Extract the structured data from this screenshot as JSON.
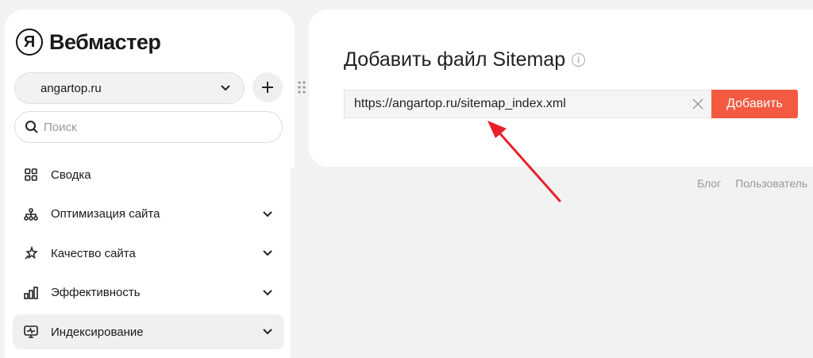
{
  "brand": {
    "logo_letter": "Я",
    "name": "Вебмастер"
  },
  "site_selector": {
    "value": "angartop.ru"
  },
  "search": {
    "placeholder": "Поиск"
  },
  "nav": {
    "items": [
      {
        "label": "Сводка",
        "icon": "grid-icon",
        "expandable": false,
        "active": false
      },
      {
        "label": "Оптимизация сайта",
        "icon": "sitemap-tree-icon",
        "expandable": true,
        "active": false
      },
      {
        "label": "Качество сайта",
        "icon": "sparkle-star-icon",
        "expandable": true,
        "active": false
      },
      {
        "label": "Эффективность",
        "icon": "bar-chart-icon",
        "expandable": true,
        "active": false
      },
      {
        "label": "Индексирование",
        "icon": "monitor-pulse-icon",
        "expandable": true,
        "active": true
      }
    ]
  },
  "panel": {
    "title": "Добавить файл Sitemap",
    "url_value": "https://angartop.ru/sitemap_index.xml",
    "add_button_label": "Добавить"
  },
  "footer": {
    "links": [
      "Блог",
      "Пользователь"
    ]
  },
  "colors": {
    "accent": "#f35a41",
    "annotation_arrow": "#e8202a",
    "background": "#f2f2f2"
  }
}
